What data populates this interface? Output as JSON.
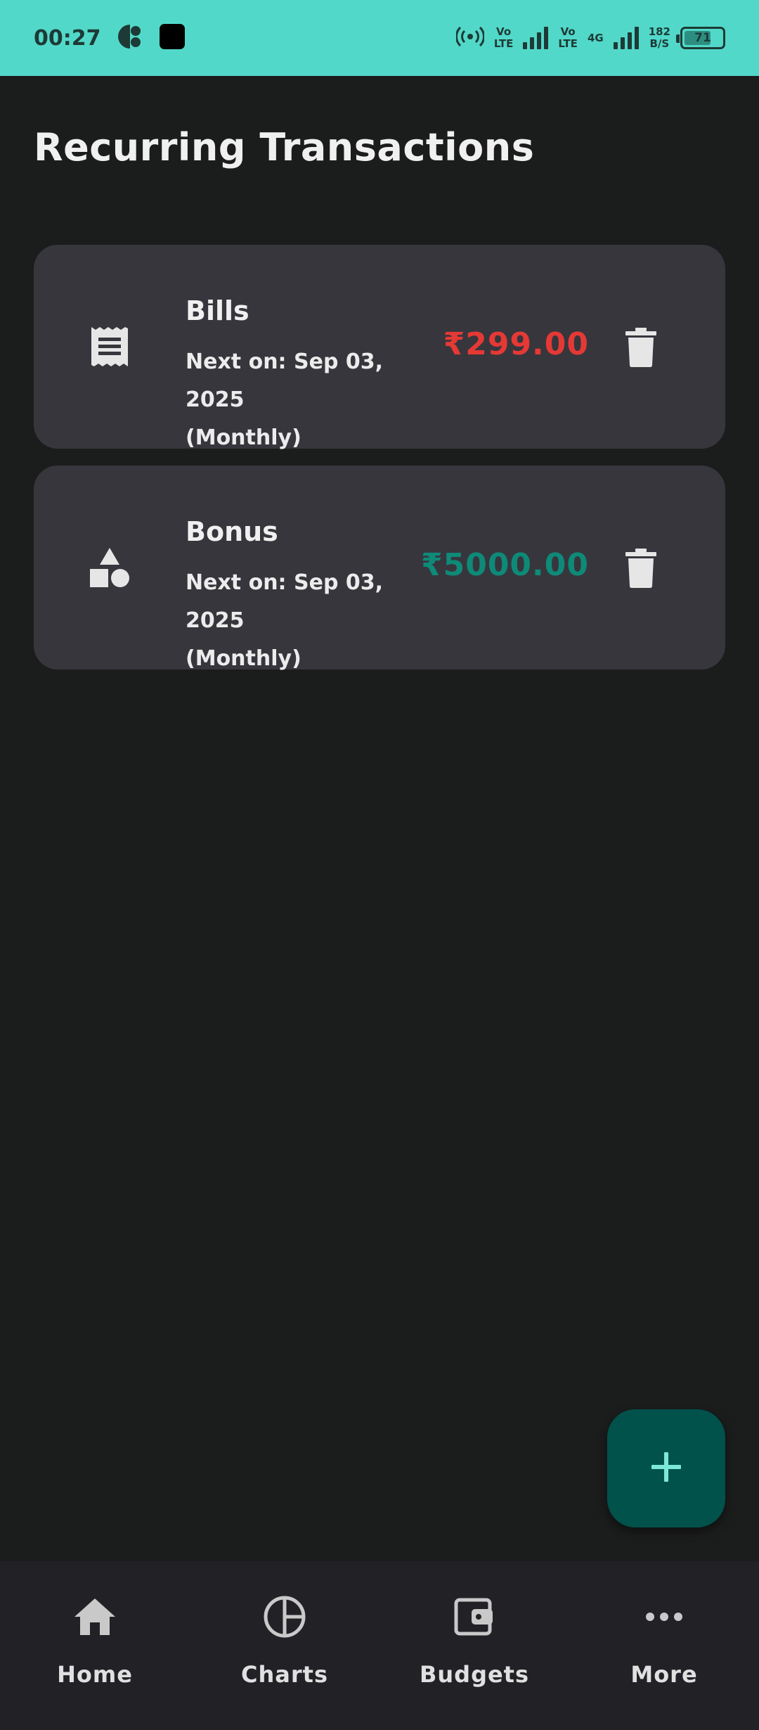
{
  "status_bar": {
    "time": "00:27",
    "network_1": "Vo\nLTE",
    "network_2": "Vo\nLTE",
    "network_type": "4G",
    "data_rate_value": "182",
    "data_rate_unit": "B/S",
    "battery_level": "71",
    "battery_fraction": 0.71
  },
  "page": {
    "title": "Recurring Transactions"
  },
  "transactions": [
    {
      "icon": "receipt-icon",
      "name": "Bills",
      "next_line": "Next on: Sep 03, 2025",
      "frequency": "(Monthly)",
      "amount": "₹299.00",
      "amount_color": "#e53935"
    },
    {
      "icon": "category-shapes-icon",
      "name": "Bonus",
      "next_line": "Next on: Sep 03, 2025",
      "frequency": "(Monthly)",
      "amount": "₹5000.00",
      "amount_color": "#0e8a78"
    }
  ],
  "fab": {
    "icon": "plus-icon"
  },
  "bottom_nav": [
    {
      "label": "Home",
      "icon": "home-icon"
    },
    {
      "label": "Charts",
      "icon": "pie-chart-icon"
    },
    {
      "label": "Budgets",
      "icon": "wallet-icon"
    },
    {
      "label": "More",
      "icon": "more-horizontal-icon"
    }
  ],
  "colors": {
    "status_bar": "#52d8c8",
    "background": "#1b1c1c",
    "card": "#37363d",
    "fab": "#00524b",
    "fab_icon": "#7de8d6",
    "nav_bar": "#212126"
  }
}
